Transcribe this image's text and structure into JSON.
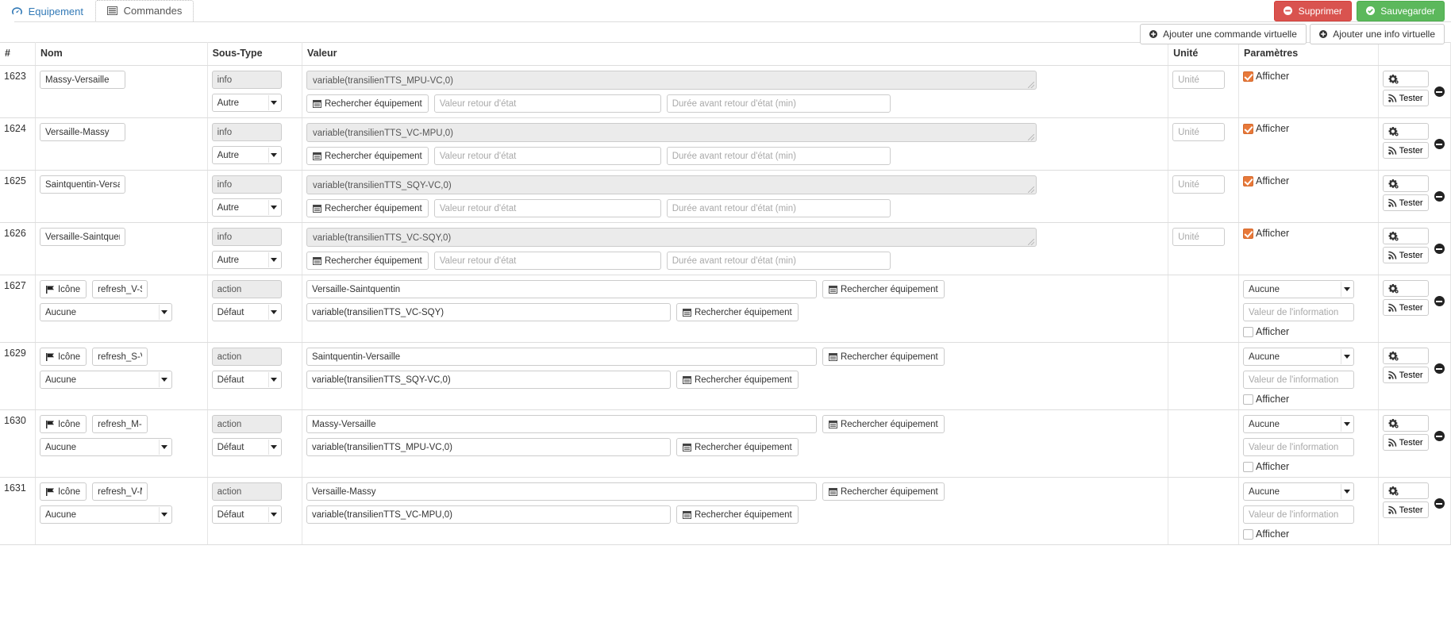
{
  "tabs": [
    {
      "label": "Equipement",
      "icon": "dashboard-icon",
      "active": false
    },
    {
      "label": "Commandes",
      "icon": "list-icon",
      "active": true
    }
  ],
  "toolbar": {
    "delete_label": "Supprimer",
    "save_label": "Sauvegarder",
    "add_virtual_command_label": "Ajouter une commande virtuelle",
    "add_virtual_info_label": "Ajouter une info virtuelle",
    "danger_color": "#d9534f",
    "success_color": "#5cb85c"
  },
  "table": {
    "headers": {
      "id": "#",
      "name": "Nom",
      "subtype": "Sous-Type",
      "value": "Valeur",
      "unit": "Unité",
      "params": "Paramètres",
      "actions": ""
    },
    "placeholders": {
      "unit": "Unité",
      "state_return_value": "Valeur retour d'état",
      "state_return_delay": "Durée avant retour d'état (min)",
      "info_value": "Valeur de l'information"
    },
    "buttons": {
      "search_equipment": "Rechercher équipement",
      "icon": "Icône",
      "test": "Tester",
      "config": "gear-cogs-icon"
    },
    "labels": {
      "display": "Afficher"
    },
    "rows": [
      {
        "kind": "info",
        "id": "1623",
        "name": "Massy-Versaille",
        "subtype": "info",
        "type_select": "Autre",
        "value": "variable(transilienTTS_MPU-VC,0)",
        "unit": "",
        "display_checked": true
      },
      {
        "kind": "info",
        "id": "1624",
        "name": "Versaille-Massy",
        "subtype": "info",
        "type_select": "Autre",
        "value": "variable(transilienTTS_VC-MPU,0)",
        "unit": "",
        "display_checked": true
      },
      {
        "kind": "info",
        "id": "1625",
        "name": "Saintquentin-Versaille",
        "subtype": "info",
        "type_select": "Autre",
        "value": "variable(transilienTTS_SQY-VC,0)",
        "unit": "",
        "display_checked": true
      },
      {
        "kind": "info",
        "id": "1626",
        "name": "Versaille-Saintquentin",
        "subtype": "info",
        "type_select": "Autre",
        "value": "variable(transilienTTS_VC-SQY,0)",
        "unit": "",
        "display_checked": true
      },
      {
        "kind": "action",
        "id": "1627",
        "icon_label": "Icône",
        "name": "refresh_V-S",
        "link_select": "Aucune",
        "subtype": "action",
        "mode_select": "Défaut",
        "value": "Versaille-Saintquentin",
        "value2": "variable(transilienTTS_VC-SQY)",
        "info_select": "Aucune",
        "info_value": "",
        "display_checked": false
      },
      {
        "kind": "action",
        "id": "1629",
        "icon_label": "Icône",
        "name": "refresh_S-V",
        "link_select": "Aucune",
        "subtype": "action",
        "mode_select": "Défaut",
        "value": "Saintquentin-Versaille",
        "value2": "variable(transilienTTS_SQY-VC,0)",
        "info_select": "Aucune",
        "info_value": "",
        "display_checked": false
      },
      {
        "kind": "action",
        "id": "1630",
        "icon_label": "Icône",
        "name": "refresh_M-V",
        "link_select": "Aucune",
        "subtype": "action",
        "mode_select": "Défaut",
        "value": "Massy-Versaille",
        "value2": "variable(transilienTTS_MPU-VC,0)",
        "info_select": "Aucune",
        "info_value": "",
        "display_checked": false
      },
      {
        "kind": "action",
        "id": "1631",
        "icon_label": "Icône",
        "name": "refresh_V-M",
        "link_select": "Aucune",
        "subtype": "action",
        "mode_select": "Défaut",
        "value": "Versaille-Massy",
        "value2": "variable(transilienTTS_VC-MPU,0)",
        "info_select": "Aucune",
        "info_value": "",
        "display_checked": false
      }
    ]
  }
}
